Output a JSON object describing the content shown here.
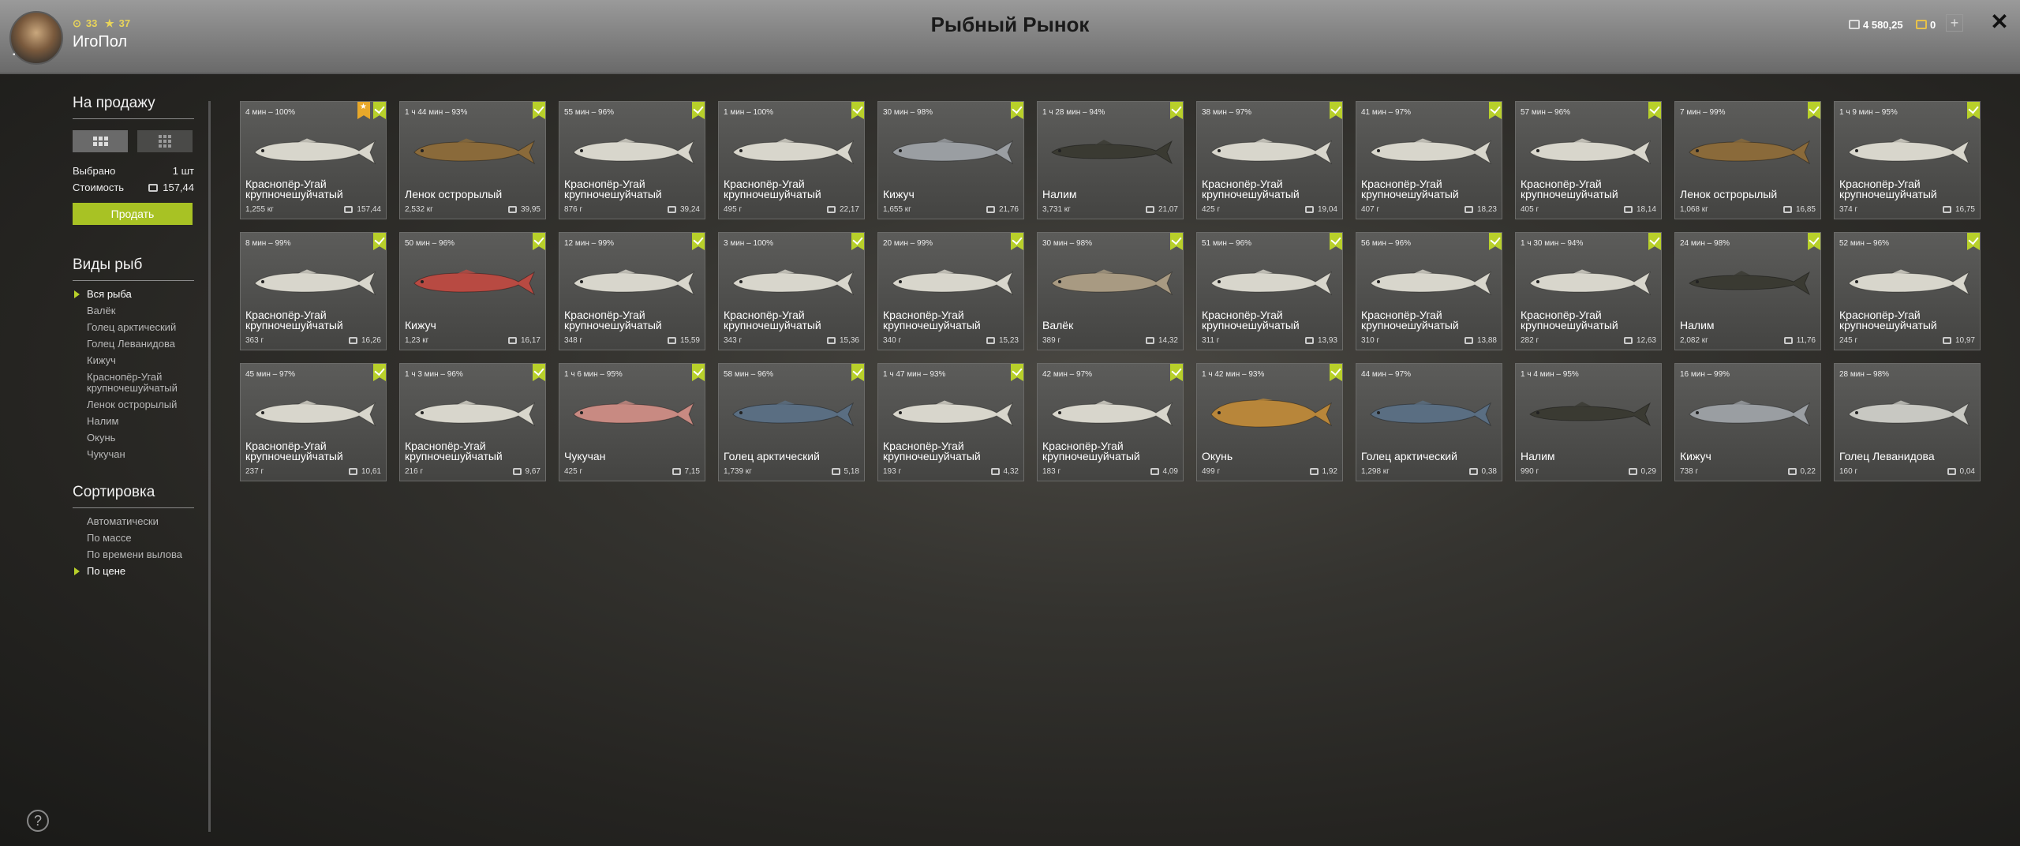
{
  "header": {
    "title": "Рыбный Рынок",
    "username": "ИгоПол",
    "stat_level": "33",
    "stat_stars": "37",
    "silver": "4 580,25",
    "gold": "0",
    "plus_label": "+",
    "close_label": "✕"
  },
  "sidebar": {
    "for_sale_title": "На продажу",
    "selected_label": "Выбрано",
    "selected_value": "1 шт",
    "cost_label": "Стоимость",
    "cost_value": "157,44",
    "sell_button": "Продать",
    "fish_types_title": "Виды рыб",
    "fish_types": [
      {
        "label": "Вся рыба",
        "active": true
      },
      {
        "label": "Валёк",
        "active": false
      },
      {
        "label": "Голец арктический",
        "active": false
      },
      {
        "label": "Голец Леванидова",
        "active": false
      },
      {
        "label": "Кижуч",
        "active": false
      },
      {
        "label": "Краснопёр-Угай крупночешуйчатый",
        "active": false
      },
      {
        "label": "Ленок острорылый",
        "active": false
      },
      {
        "label": "Налим",
        "active": false
      },
      {
        "label": "Окунь",
        "active": false
      },
      {
        "label": "Чукучан",
        "active": false
      }
    ],
    "sort_title": "Сортировка",
    "sort_options": [
      {
        "label": "Автоматически",
        "active": false
      },
      {
        "label": "По массе",
        "active": false
      },
      {
        "label": "По времени вылова",
        "active": false
      },
      {
        "label": "По цене",
        "active": true
      }
    ]
  },
  "help_label": "?",
  "fish_colors": {
    "ugai": "#d8d6cc",
    "lenok": "#8a6a3a",
    "kizhuch": "#9a9ea2",
    "nalim": "#3a3a32",
    "kizhuch_red": "#b84a42",
    "valek": "#a89a82",
    "chukuchan": "#c88a82",
    "golets": "#5a6e82",
    "okun": "#b8863a",
    "golets_lev": "#c8c8c2"
  },
  "cards": [
    {
      "time": "4 мин – 100%",
      "name": "Краснопёр-Угай крупночешуйчатый",
      "weight": "1,255 кг",
      "price": "157,44",
      "fish": "ugai",
      "check": true,
      "star": true
    },
    {
      "time": "1 ч 44 мин – 93%",
      "name": "Ленок острорылый",
      "weight": "2,532 кг",
      "price": "39,95",
      "fish": "lenok",
      "check": true,
      "star": false
    },
    {
      "time": "55 мин – 96%",
      "name": "Краснопёр-Угай крупночешуйчатый",
      "weight": "876 г",
      "price": "39,24",
      "fish": "ugai",
      "check": true,
      "star": false
    },
    {
      "time": "1 мин – 100%",
      "name": "Краснопёр-Угай крупночешуйчатый",
      "weight": "495 г",
      "price": "22,17",
      "fish": "ugai",
      "check": true,
      "star": false
    },
    {
      "time": "30 мин – 98%",
      "name": "Кижуч",
      "weight": "1,655 кг",
      "price": "21,76",
      "fish": "kizhuch",
      "check": true,
      "star": false
    },
    {
      "time": "1 ч 28 мин – 94%",
      "name": "Налим",
      "weight": "3,731 кг",
      "price": "21,07",
      "fish": "nalim",
      "check": true,
      "star": false
    },
    {
      "time": "38 мин – 97%",
      "name": "Краснопёр-Угай крупночешуйчатый",
      "weight": "425 г",
      "price": "19,04",
      "fish": "ugai",
      "check": true,
      "star": false
    },
    {
      "time": "41 мин – 97%",
      "name": "Краснопёр-Угай крупночешуйчатый",
      "weight": "407 г",
      "price": "18,23",
      "fish": "ugai",
      "check": true,
      "star": false
    },
    {
      "time": "57 мин – 96%",
      "name": "Краснопёр-Угай крупночешуйчатый",
      "weight": "405 г",
      "price": "18,14",
      "fish": "ugai",
      "check": true,
      "star": false
    },
    {
      "time": "7 мин – 99%",
      "name": "Ленок острорылый",
      "weight": "1,068 кг",
      "price": "16,85",
      "fish": "lenok",
      "check": true,
      "star": false
    },
    {
      "time": "1 ч 9 мин – 95%",
      "name": "Краснопёр-Угай крупночешуйчатый",
      "weight": "374 г",
      "price": "16,75",
      "fish": "ugai",
      "check": true,
      "star": false
    },
    {
      "time": "8 мин – 99%",
      "name": "Краснопёр-Угай крупночешуйчатый",
      "weight": "363 г",
      "price": "16,26",
      "fish": "ugai",
      "check": true,
      "star": false
    },
    {
      "time": "50 мин – 96%",
      "name": "Кижуч",
      "weight": "1,23 кг",
      "price": "16,17",
      "fish": "kizhuch_red",
      "check": true,
      "star": false
    },
    {
      "time": "12 мин – 99%",
      "name": "Краснопёр-Угай крупночешуйчатый",
      "weight": "348 г",
      "price": "15,59",
      "fish": "ugai",
      "check": true,
      "star": false
    },
    {
      "time": "3 мин – 100%",
      "name": "Краснопёр-Угай крупночешуйчатый",
      "weight": "343 г",
      "price": "15,36",
      "fish": "ugai",
      "check": true,
      "star": false
    },
    {
      "time": "20 мин – 99%",
      "name": "Краснопёр-Угай крупночешуйчатый",
      "weight": "340 г",
      "price": "15,23",
      "fish": "ugai",
      "check": true,
      "star": false
    },
    {
      "time": "30 мин – 98%",
      "name": "Валёк",
      "weight": "389 г",
      "price": "14,32",
      "fish": "valek",
      "check": true,
      "star": false
    },
    {
      "time": "51 мин – 96%",
      "name": "Краснопёр-Угай крупночешуйчатый",
      "weight": "311 г",
      "price": "13,93",
      "fish": "ugai",
      "check": true,
      "star": false
    },
    {
      "time": "56 мин – 96%",
      "name": "Краснопёр-Угай крупночешуйчатый",
      "weight": "310 г",
      "price": "13,88",
      "fish": "ugai",
      "check": true,
      "star": false
    },
    {
      "time": "1 ч 30 мин – 94%",
      "name": "Краснопёр-Угай крупночешуйчатый",
      "weight": "282 г",
      "price": "12,63",
      "fish": "ugai",
      "check": true,
      "star": false
    },
    {
      "time": "24 мин – 98%",
      "name": "Налим",
      "weight": "2,082 кг",
      "price": "11,76",
      "fish": "nalim",
      "check": true,
      "star": false
    },
    {
      "time": "52 мин – 96%",
      "name": "Краснопёр-Угай крупночешуйчатый",
      "weight": "245 г",
      "price": "10,97",
      "fish": "ugai",
      "check": true,
      "star": false
    },
    {
      "time": "45 мин – 97%",
      "name": "Краснопёр-Угай крупночешуйчатый",
      "weight": "237 г",
      "price": "10,61",
      "fish": "ugai",
      "check": true,
      "star": false
    },
    {
      "time": "1 ч 3 мин – 96%",
      "name": "Краснопёр-Угай крупночешуйчатый",
      "weight": "216 г",
      "price": "9,67",
      "fish": "ugai",
      "check": true,
      "star": false
    },
    {
      "time": "1 ч 6 мин – 95%",
      "name": "Чукучан",
      "weight": "425 г",
      "price": "7,15",
      "fish": "chukuchan",
      "check": true,
      "star": false
    },
    {
      "time": "58 мин – 96%",
      "name": "Голец арктический",
      "weight": "1,739 кг",
      "price": "5,18",
      "fish": "golets",
      "check": true,
      "star": false
    },
    {
      "time": "1 ч 47 мин – 93%",
      "name": "Краснопёр-Угай крупночешуйчатый",
      "weight": "193 г",
      "price": "4,32",
      "fish": "ugai",
      "check": true,
      "star": false
    },
    {
      "time": "42 мин – 97%",
      "name": "Краснопёр-Угай крупночешуйчатый",
      "weight": "183 г",
      "price": "4,09",
      "fish": "ugai",
      "check": true,
      "star": false
    },
    {
      "time": "1 ч 42 мин – 93%",
      "name": "Окунь",
      "weight": "499 г",
      "price": "1,92",
      "fish": "okun",
      "check": true,
      "star": false
    },
    {
      "time": "44 мин – 97%",
      "name": "Голец арктический",
      "weight": "1,298 кг",
      "price": "0,38",
      "fish": "golets",
      "check": false,
      "star": false
    },
    {
      "time": "1 ч 4 мин – 95%",
      "name": "Налим",
      "weight": "990 г",
      "price": "0,29",
      "fish": "nalim",
      "check": false,
      "star": false
    },
    {
      "time": "16 мин – 99%",
      "name": "Кижуч",
      "weight": "738 г",
      "price": "0,22",
      "fish": "kizhuch",
      "check": false,
      "star": false
    },
    {
      "time": "28 мин – 98%",
      "name": "Голец Леванидова",
      "weight": "160 г",
      "price": "0,04",
      "fish": "golets_lev",
      "check": false,
      "star": false
    }
  ]
}
